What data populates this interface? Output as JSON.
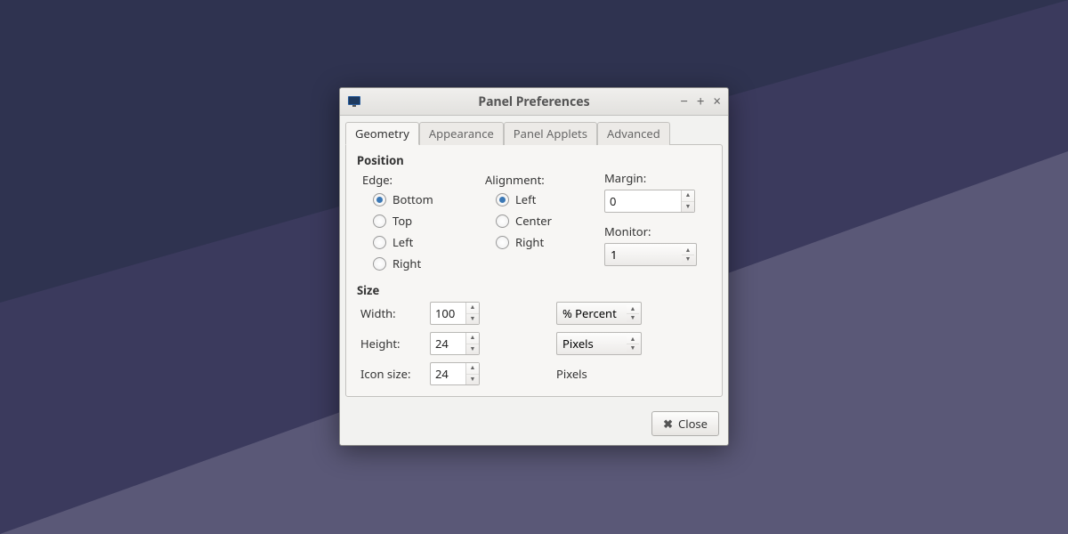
{
  "window": {
    "title": "Panel Preferences"
  },
  "tabs": [
    "Geometry",
    "Appearance",
    "Panel Applets",
    "Advanced"
  ],
  "position": {
    "heading": "Position",
    "edge_label": "Edge:",
    "edge_options": [
      "Bottom",
      "Top",
      "Left",
      "Right"
    ],
    "edge_selected": "Bottom",
    "alignment_label": "Alignment:",
    "alignment_options": [
      "Left",
      "Center",
      "Right"
    ],
    "alignment_selected": "Left",
    "margin_label": "Margin:",
    "margin_value": "0",
    "monitor_label": "Monitor:",
    "monitor_value": "1"
  },
  "size": {
    "heading": "Size",
    "width_label": "Width:",
    "width_value": "100",
    "width_unit": "% Percent",
    "height_label": "Height:",
    "height_value": "24",
    "height_unit": "Pixels",
    "iconsize_label": "Icon size:",
    "iconsize_value": "24",
    "iconsize_unit": "Pixels"
  },
  "buttons": {
    "close": "Close"
  }
}
